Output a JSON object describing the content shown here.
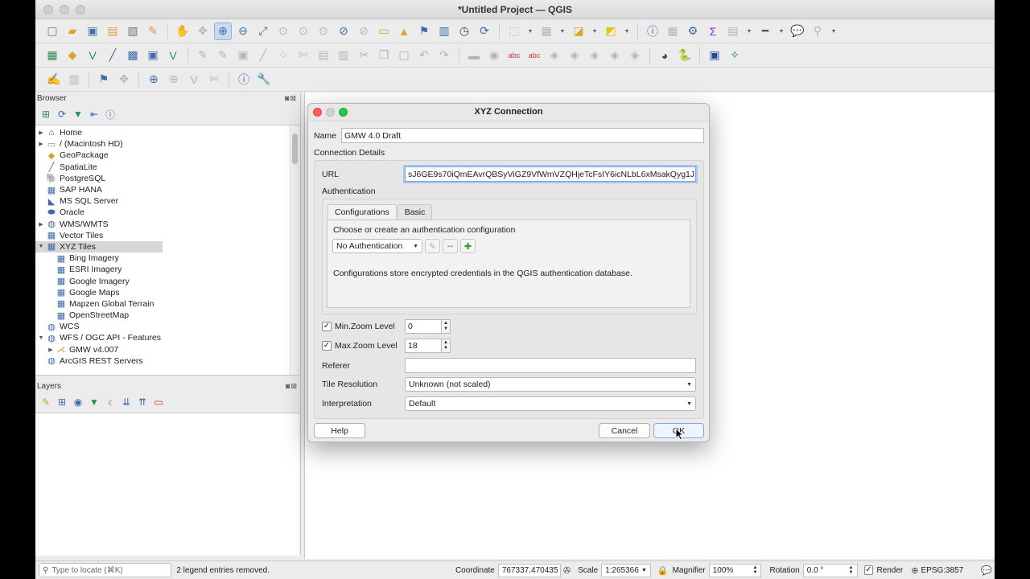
{
  "window": {
    "title": "*Untitled Project — QGIS"
  },
  "browser": {
    "title": "Browser",
    "items": [
      {
        "label": "Home",
        "icon": "home-icon",
        "arrow": "▶",
        "indent": 0
      },
      {
        "label": "/ (Macintosh HD)",
        "icon": "folder-icon",
        "arrow": "▶",
        "indent": 0
      },
      {
        "label": "GeoPackage",
        "icon": "geopackage-icon",
        "arrow": "",
        "indent": 0
      },
      {
        "label": "SpatiaLite",
        "icon": "spatialite-icon",
        "arrow": "",
        "indent": 0
      },
      {
        "label": "PostgreSQL",
        "icon": "postgresql-icon",
        "arrow": "",
        "indent": 0
      },
      {
        "label": "SAP HANA",
        "icon": "sap-hana-icon",
        "arrow": "",
        "indent": 0
      },
      {
        "label": "MS SQL Server",
        "icon": "mssql-icon",
        "arrow": "",
        "indent": 0
      },
      {
        "label": "Oracle",
        "icon": "oracle-icon",
        "arrow": "",
        "indent": 0
      },
      {
        "label": "WMS/WMTS",
        "icon": "globe-icon",
        "arrow": "▶",
        "indent": 0
      },
      {
        "label": "Vector Tiles",
        "icon": "grid-icon",
        "arrow": "",
        "indent": 0
      },
      {
        "label": "XYZ Tiles",
        "icon": "grid-icon",
        "arrow": "▼",
        "indent": 0,
        "selected": true
      },
      {
        "label": "Bing Imagery",
        "icon": "grid-icon",
        "arrow": "",
        "indent": 1
      },
      {
        "label": "ESRI Imagery",
        "icon": "grid-icon",
        "arrow": "",
        "indent": 1
      },
      {
        "label": "Google Imagery",
        "icon": "grid-icon",
        "arrow": "",
        "indent": 1
      },
      {
        "label": "Google Maps",
        "icon": "grid-icon",
        "arrow": "",
        "indent": 1
      },
      {
        "label": "Mapzen Global Terrain",
        "icon": "grid-icon",
        "arrow": "",
        "indent": 1
      },
      {
        "label": "OpenStreetMap",
        "icon": "grid-icon",
        "arrow": "",
        "indent": 1
      },
      {
        "label": "WCS",
        "icon": "globe-icon",
        "arrow": "",
        "indent": 0
      },
      {
        "label": "WFS / OGC API - Features",
        "icon": "globe-icon",
        "arrow": "▼",
        "indent": 0
      },
      {
        "label": "GMW v4.007",
        "icon": "vector-layer-icon",
        "arrow": "▶",
        "indent": 1
      },
      {
        "label": "ArcGIS REST Servers",
        "icon": "globe-icon",
        "arrow": "",
        "indent": 0
      }
    ]
  },
  "layers": {
    "title": "Layers"
  },
  "dialog": {
    "title": "XYZ Connection",
    "name_label": "Name",
    "name_value": "GMW 4.0 Draft",
    "connection_details": "Connection Details",
    "url_label": "URL",
    "url_value": "sJ6GE9s70iQmEAvrQBSyViGZ9VfWmVZQHjeTcFsIY6icNLbL6xMsakQyg1J",
    "authentication": "Authentication",
    "tab_configurations": "Configurations",
    "tab_basic": "Basic",
    "choose_text": "Choose or create an authentication configuration",
    "auth_select": "No Authentication",
    "config_info": "Configurations store encrypted credentials in the QGIS authentication database.",
    "min_zoom_label": "Min.Zoom Level",
    "min_zoom_value": "0",
    "max_zoom_label": "Max.Zoom Level",
    "max_zoom_value": "18",
    "referer_label": "Referer",
    "referer_value": "",
    "tile_res_label": "Tile Resolution",
    "tile_res_value": "Unknown (not scaled)",
    "interp_label": "Interpretation",
    "interp_value": "Default",
    "help": "Help",
    "cancel": "Cancel",
    "ok": "OK"
  },
  "status": {
    "locate_placeholder": "Type to locate (⌘K)",
    "message": "2 legend entries removed.",
    "coordinate_label": "Coordinate",
    "coordinate_value": "767337,470435",
    "scale_label": "Scale",
    "scale_value": "1:265366",
    "magnifier_label": "Magnifier",
    "magnifier_value": "100%",
    "rotation_label": "Rotation",
    "rotation_value": "0.0 °",
    "render_label": "Render",
    "epsg": "EPSG:3857"
  }
}
